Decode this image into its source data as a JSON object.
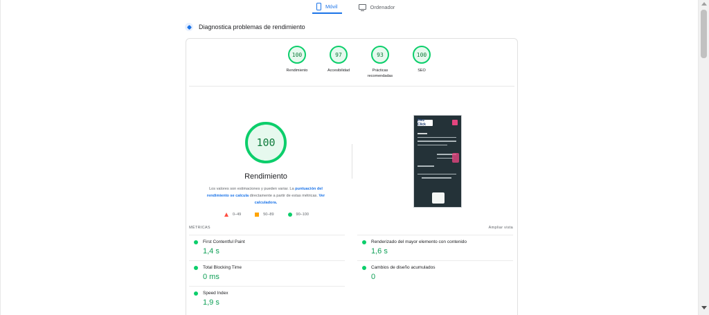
{
  "device_tabs": {
    "mobile": "Móvil",
    "desktop": "Ordenador"
  },
  "diagnose": {
    "title": "Diagnostica problemas de rendimiento"
  },
  "categories": [
    {
      "score": "100",
      "label": "Rendimiento"
    },
    {
      "score": "97",
      "label": "Accesibilidad"
    },
    {
      "score": "93",
      "label": "Prácticas recomendadas"
    },
    {
      "score": "100",
      "label": "SEO"
    }
  ],
  "performance": {
    "score": "100",
    "title": "Rendimiento",
    "desc_prefix": "Los valores son estimaciones y pueden variar. La ",
    "desc_link1": "puntuación del rendimiento se calcula",
    "desc_middle": " directamente a partir de estas métricas. ",
    "desc_link2": "Ver calculadora."
  },
  "legend": {
    "fail": "0–49",
    "average": "50–89",
    "pass": "90–100"
  },
  "thumbnail": {
    "logo_text": "Diez Click"
  },
  "metrics_section": {
    "heading": "MÉTRICAS",
    "expand": "Ampliar vista"
  },
  "metrics": [
    {
      "name": "First Contentful Paint",
      "value": "1,4 s"
    },
    {
      "name": "Renderizado del mayor elemento con contenido",
      "value": "1,6 s"
    },
    {
      "name": "Total Blocking Time",
      "value": "0 ms"
    },
    {
      "name": "Cambios de diseño acumulados",
      "value": "0"
    },
    {
      "name": "Speed Index",
      "value": "1,9 s"
    }
  ],
  "colors": {
    "pass": "#0cce6b",
    "average": "#ffa400",
    "fail": "#ff4e42",
    "accent": "#1a73e8"
  }
}
